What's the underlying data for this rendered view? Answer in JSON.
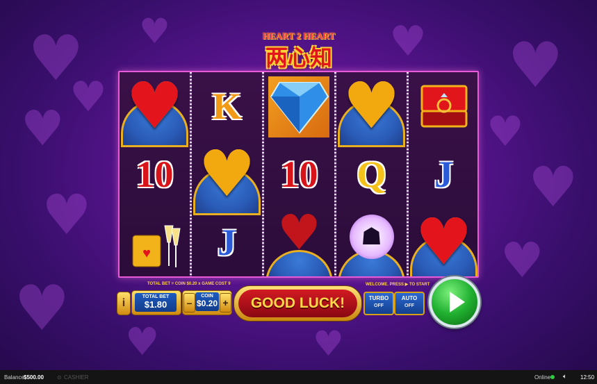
{
  "logo": {
    "top": "HEART 2 HEART",
    "main": "两心知"
  },
  "reels": [
    [
      {
        "kind": "heart-red"
      },
      {
        "kind": "card",
        "text": "10",
        "color": "#d8141b"
      },
      {
        "kind": "champagne"
      }
    ],
    [
      {
        "kind": "card",
        "text": "K",
        "color": "#f29a16"
      },
      {
        "kind": "heart-gold"
      },
      {
        "kind": "card",
        "text": "J",
        "color": "#2a5ad8"
      }
    ],
    [
      {
        "kind": "diamond"
      },
      {
        "kind": "card",
        "text": "10",
        "color": "#d8141b"
      },
      {
        "kind": "chocolates"
      }
    ],
    [
      {
        "kind": "heart-gold"
      },
      {
        "kind": "card",
        "text": "Q",
        "color": "#f4c21a"
      },
      {
        "kind": "couple"
      }
    ],
    [
      {
        "kind": "ring"
      },
      {
        "kind": "card",
        "text": "J",
        "color": "#2a5ad8"
      },
      {
        "kind": "heart-red"
      }
    ]
  ],
  "controls": {
    "total_bet_info": "TOTAL BET = COIN $0.20 x GAME COST 9",
    "welcome_text": "WELCOME. PRESS ▶ TO START",
    "info_label": "i",
    "total_bet_label": "TOTAL BET",
    "total_bet_value": "$1.80",
    "coin_label": "COIN",
    "coin_value": "$0.20",
    "minus": "–",
    "plus": "+",
    "good_luck": "GOOD LUCK!",
    "turbo_label": "TURBO",
    "turbo_state": "OFF",
    "auto_label": "AUTO",
    "auto_state": "OFF"
  },
  "footer": {
    "balance_label": "Balance",
    "balance_value": "$500.00",
    "cashier_label": "CASHIER",
    "online_label": "Online",
    "time": "12:50"
  },
  "colors": {
    "accent_red": "#d21a22",
    "accent_gold": "#ffd84a",
    "spin_green": "#20b030",
    "online": "#2ecc40"
  }
}
